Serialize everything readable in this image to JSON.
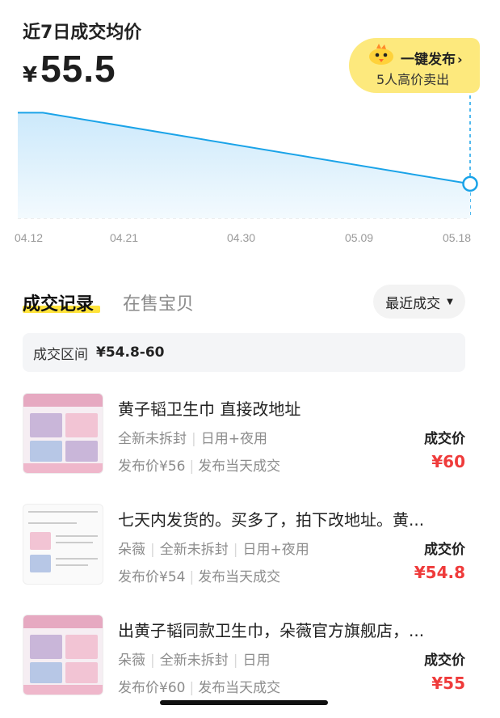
{
  "header": {
    "title": "近7日成交均价",
    "currency": "¥",
    "avg_price": "55.5"
  },
  "publish_button": {
    "label": "一键发布",
    "chevron": "›",
    "subtext": "5人高价卖出",
    "icon": "chick-mascot-icon"
  },
  "chart_data": {
    "type": "area",
    "x": [
      "04.12",
      "04.21",
      "04.30",
      "05.09",
      "05.18"
    ],
    "xlabels": [
      "04.12",
      "04.21",
      "04.30",
      "05.09",
      "05.18"
    ],
    "points": [
      {
        "x": "04.12",
        "y": 58.6
      },
      {
        "x": "04.14",
        "y": 58.6
      },
      {
        "x": "05.18",
        "y": 55.5
      }
    ],
    "ylim": [
      54,
      59
    ],
    "grid": false,
    "colors": {
      "line": "#1aa3e8",
      "fill": "#d6eefc"
    }
  },
  "tabs": {
    "active": "成交记录",
    "inactive": "在售宝贝",
    "underline_color": "#ffe33b"
  },
  "sort": {
    "label": "最近成交",
    "icon": "caret-down-icon"
  },
  "range": {
    "label": "成交区间",
    "value": "¥54.8-60"
  },
  "deal_label": "成交价",
  "items": [
    {
      "title": "黄子韬卫生巾 直接改地址",
      "tags": [
        "全新未拆封",
        "日用+夜用"
      ],
      "publish_price": "发布价¥56",
      "status": "发布当天成交",
      "deal_price": "¥60"
    },
    {
      "title": "七天内发货的。买多了，拍下改地址。黄...",
      "tags": [
        "朵薇",
        "全新未拆封",
        "日用+夜用"
      ],
      "publish_price": "发布价¥54",
      "status": "发布当天成交",
      "deal_price": "¥54.8"
    },
    {
      "title": "出黄子韬同款卫生巾，朵薇官方旗舰店，...",
      "tags": [
        "朵薇",
        "全新未拆封",
        "日用"
      ],
      "publish_price": "发布价¥60",
      "status": "发布当天成交",
      "deal_price": "¥55"
    }
  ],
  "colors": {
    "accent_price": "#ef3b3b",
    "publish_bg": "#fde97d",
    "chart_line": "#1aa3e8"
  }
}
